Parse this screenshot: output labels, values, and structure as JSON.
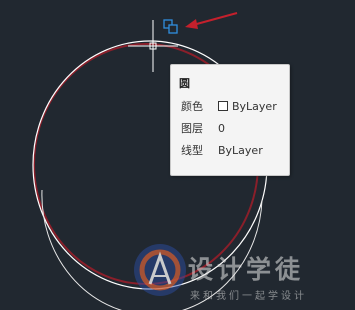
{
  "tooltip": {
    "title": "圆",
    "rows": [
      {
        "label": "颜色",
        "value": "ByLayer",
        "has_swatch": true
      },
      {
        "label": "图层",
        "value": "0",
        "has_swatch": false
      },
      {
        "label": "线型",
        "value": "ByLayer",
        "has_swatch": false
      }
    ]
  },
  "watermark": {
    "title": "设计学徒",
    "subtitle": "来和我们一起学设计"
  },
  "colors": {
    "background": "#212830",
    "circle_red": "#8a1f2a",
    "circle_white": "#ffffff",
    "arrow_red": "#c4202c",
    "icon_blue": "#2f8fe0"
  },
  "icons": {
    "selection_cycling": "selection-cycling-icon",
    "annotation_arrow": "red-arrow-icon",
    "logo": "design-apprentice-logo"
  }
}
